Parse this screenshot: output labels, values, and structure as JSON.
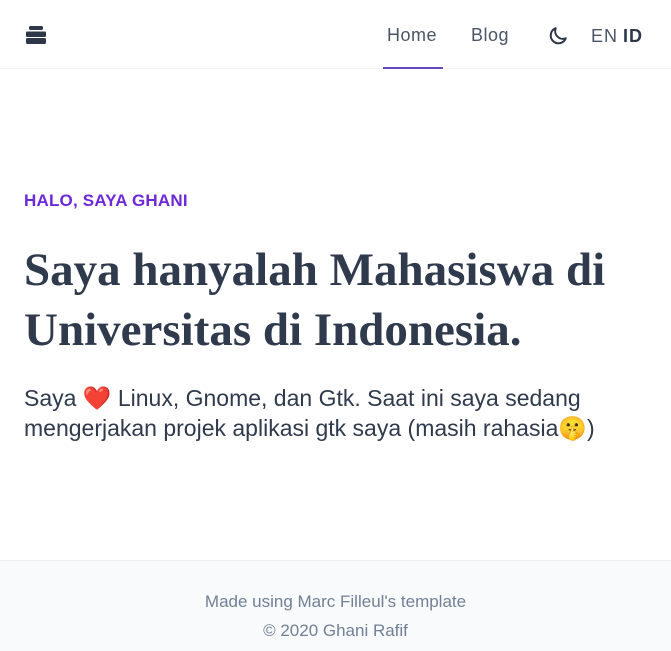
{
  "header": {
    "logo_icon": "stack-icon",
    "nav": [
      {
        "label": "Home",
        "active": true
      },
      {
        "label": "Blog",
        "active": false
      }
    ],
    "theme_icon": "moon-icon",
    "lang_en": "EN",
    "lang_id": "ID",
    "accent_color": "#6b46c1"
  },
  "hero": {
    "eyebrow": "HALO, SAYA GHANI",
    "headline": "Saya hanyalah Mahasiswa di Universitas di Indonesia.",
    "lead": "Saya ❤️ Linux, Gnome, dan Gtk. Saat ini saya sedang mengerjakan projek aplikasi gtk saya (masih rahasia🤫)"
  },
  "footer": {
    "line1": "Made using Marc Filleul's template",
    "line2": "© 2020 Ghani Rafif"
  }
}
